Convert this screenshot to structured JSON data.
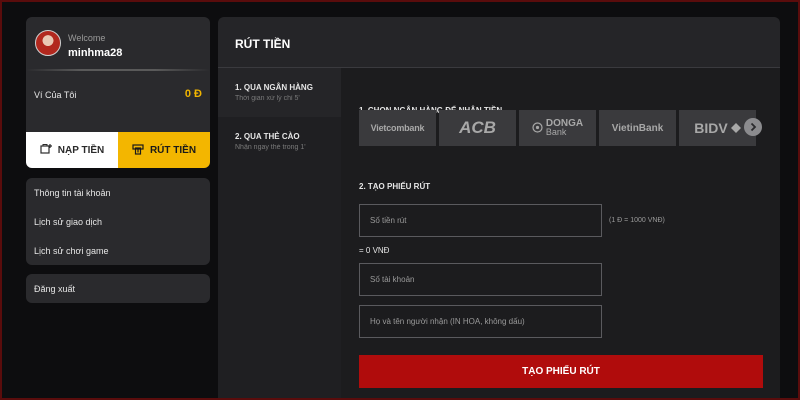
{
  "user": {
    "welcome": "Welcome",
    "username": "minhma28",
    "wallet_label": "Ví Của Tôi",
    "wallet_value": "0 Đ"
  },
  "actions": {
    "deposit_label": "NẠP TIỀN",
    "withdraw_label": "RÚT TIỀN"
  },
  "menu": [
    {
      "label": "Thông tin tài khoản"
    },
    {
      "label": "Lịch sử giao dịch"
    },
    {
      "label": "Lịch sử chơi game"
    }
  ],
  "logout_label": "Đăng xuất",
  "main": {
    "title": "RÚT TIỀN",
    "tabs": [
      {
        "title": "1. QUA NGÂN HÀNG",
        "subtitle": "Thời gian xử lý chỉ 5'"
      },
      {
        "title": "2. QUA THẺ CÀO",
        "subtitle": "Nhận ngay thẻ trong 1'"
      }
    ],
    "section1": "1. CHỌN NGÂN HÀNG ĐỂ NHẬN TIỀN",
    "banks": [
      {
        "name": "Vietcombank"
      },
      {
        "name": "ACB"
      },
      {
        "name": "DONGA",
        "sub": "Bank"
      },
      {
        "name": "VietinBank"
      },
      {
        "name": "BIDV"
      }
    ],
    "section2": "2. TẠO PHIẾU RÚT",
    "amount_placeholder": "Số tiền rút",
    "rate_note": "(1 Đ = 1000 VNĐ)",
    "converted": "= 0 VNĐ",
    "account_placeholder": "Số tài khoản",
    "name_placeholder": "Họ và tên người nhận (IN HOA, không dấu)",
    "submit_label": "TẠO PHIẾU RÚT"
  },
  "colors": {
    "accent": "#f3b600",
    "primary_button": "#b00c0c",
    "panel": "#252528",
    "background": "#0d0d0f"
  },
  "icons": {
    "deposit": "wallet-plus-icon",
    "withdraw": "cash-out-icon",
    "next": "chevron-right-icon"
  }
}
